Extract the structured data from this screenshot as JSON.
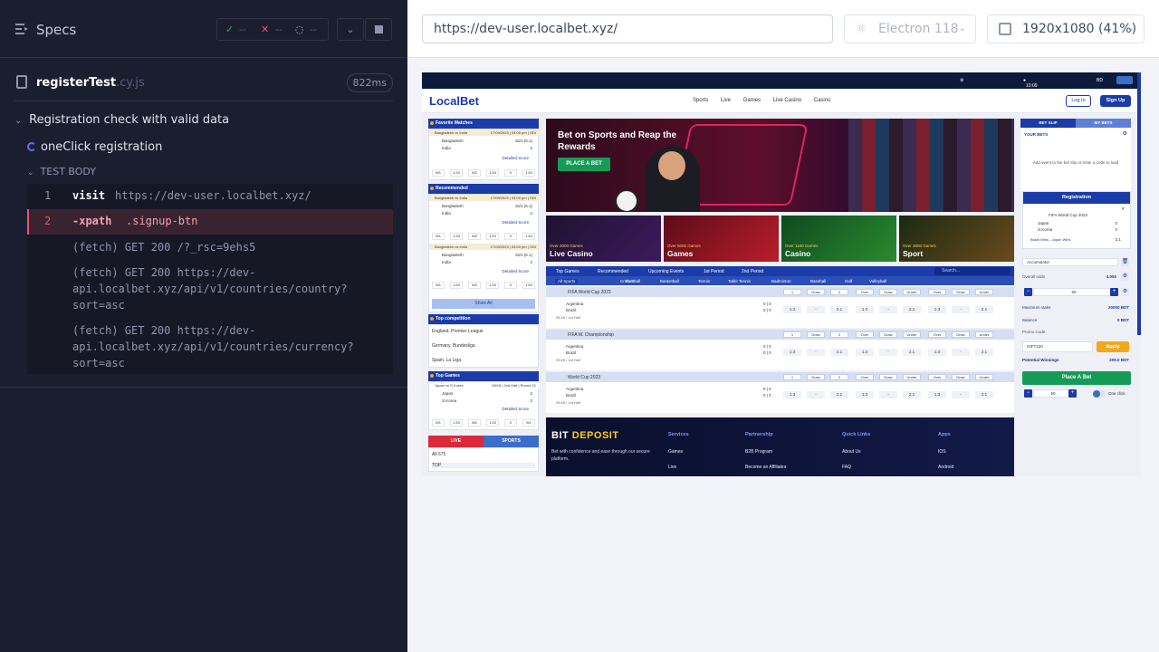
{
  "reporter": {
    "specs_label": "Specs",
    "stats": {
      "passed": "--",
      "failed": "--",
      "pending": "--"
    },
    "file": {
      "name": "registerTest",
      "ext": ".cy.js",
      "duration": "822ms"
    },
    "suite": "Registration check with valid data",
    "test": "oneClick registration",
    "body_label": "TEST BODY",
    "commands": [
      {
        "num": "1",
        "name": "visit",
        "message": "https://dev-user.localbet.xyz/"
      },
      {
        "num": "2",
        "name": "-xpath",
        "message": ".signup-btn"
      }
    ],
    "logs": [
      "(fetch)    GET 200 /?_rsc=9ehs5",
      "(fetch)    GET 200 https://dev-api.localbet.xyz/api/v1/countries/country?sort=asc",
      "(fetch)    GET 200 https://dev-api.localbet.xyz/api/v1/countries/currency?sort=asc"
    ]
  },
  "aut_header": {
    "url": "https://dev-user.localbet.xyz/",
    "browser": "Electron 118",
    "viewport": "1920x1080  (41%)"
  },
  "site": {
    "top_time": "10:09 AM",
    "top_lang": "BD",
    "logo": "LocalBet",
    "nav": [
      "Sports",
      "Live",
      "Games",
      "Live Casino",
      "Casino"
    ],
    "login": "Log In",
    "signup": "Sign Up",
    "left": {
      "favorites": "Favorite Matches",
      "recommended": "Recommended",
      "top_competition": "Top competition",
      "top_games": "Top Games",
      "match_title": "Bangladesh vs India",
      "match_date": "17/09/2023 | 03:00 pm | ODI",
      "team1": "Bangladesh",
      "team2": "India",
      "score1": "15/1 (6.1)",
      "score2": "2",
      "detailed": "Detailed Score",
      "odds": [
        "W1",
        "1.53",
        "W2",
        "1.53",
        "X",
        "1.53"
      ],
      "show_all": "Show All",
      "competitions": [
        "England. Premier League",
        "Germany. Bundesliga",
        "Spain. La Liga"
      ],
      "game_title": "Japan vs S.Korea",
      "game_date": "09/18 | 2nd Half | Round 21",
      "game_team1": "Japan",
      "game_team2": "S.Korea",
      "game_score1": "2",
      "game_score2": "2",
      "live_tab": "LIVE",
      "sports_tab": "SPORTS",
      "all_count": "All 675",
      "top": "TOP"
    },
    "hero": {
      "title": "Bet on Sports and Reap the Rewards",
      "button": "PLACE A BET"
    },
    "tiles": [
      {
        "over": "Over 3000 Games",
        "title": "Live Casino"
      },
      {
        "over": "Over 5000 Games",
        "title": "Games"
      },
      {
        "over": "Over 1100 Games",
        "title": "Casino"
      },
      {
        "over": "Over 3000 Games",
        "title": "Sport"
      }
    ],
    "events_bar": [
      "Top Games",
      "Recommended",
      "Upcoming Events",
      "1st Period",
      "2nd Period"
    ],
    "search": "Search...",
    "sports": [
      "All Sports",
      "Cricket",
      "Football",
      "Basketball",
      "Tennis",
      "Table Tennis",
      "Badminton",
      "Baseball",
      "Golf",
      "Volleyball"
    ],
    "games": [
      {
        "league": "FIFA World Cup 2023",
        "t1": "Argentina",
        "t2": "Brazil",
        "time": "25:45 / 1st Half"
      },
      {
        "league": "FIFA W. Championship",
        "t1": "Argentina",
        "t2": "Brazil",
        "time": "25:45 / 1st Half"
      },
      {
        "league": "World Cup 2023",
        "t1": "Argentina",
        "t2": "Brazil",
        "time": "25:45 / 1st Half"
      }
    ],
    "game_headers": [
      "1",
      "Draw",
      "2",
      "Over",
      "Draw",
      "Under",
      "Over",
      "Draw",
      "Under"
    ],
    "game_odds": [
      "1.3",
      "-",
      "2.1",
      "1.3",
      "-",
      "2.1",
      "1.3",
      "-",
      "2.1"
    ],
    "footer": {
      "logo_a": "BIT ",
      "logo_b": "DEPOSIT",
      "desc": "Bet with confidence and ease through our secure platform.",
      "cols": [
        {
          "h": "Services",
          "items": [
            "Games",
            "Live"
          ]
        },
        {
          "h": "Partnership",
          "items": [
            "B2B Program",
            "Become an Affiliates"
          ]
        },
        {
          "h": "Quick Links",
          "items": [
            "About Us",
            "FAQ"
          ]
        },
        {
          "h": "Apps",
          "items": [
            "IOS",
            "Android"
          ]
        }
      ]
    },
    "betslip": {
      "tab1": "BET SLIP",
      "tab2": "MY BETS",
      "your_bets": "YOUR BETS",
      "empty": "Add event to the bet slip or enter a code to load",
      "reg_title": "Registration",
      "reg_league": "FIFA World Cup 2023",
      "reg_t1": "Japan",
      "reg_t2": "S.Korea",
      "reg_s1": "0",
      "reg_s2": "0",
      "reg_line": "Brazil Wins - Japan Wins",
      "reg_odd": "2.1",
      "accumulator": "Accumulator",
      "overall_label": "Overall odds",
      "overall_val": "4.050",
      "stake": "50",
      "max_stake_label": "Maximum stake",
      "max_stake_val": "20000 BDT",
      "balance_label": "Balance",
      "balance_val": "0 BDT",
      "promo_label": "Promo Code",
      "promo_val": "GIFT220",
      "apply": "Apply",
      "potential_label": "Potential Winnings",
      "potential_val": "209.0 BDT",
      "place_bet": "Place A Bet",
      "stake2": "50",
      "one_click": "One click"
    }
  },
  "colors": {
    "accent": "#1a3ba8",
    "pass": "#1fa971",
    "fail": "#e45770",
    "reporter_bg": "#1b1e2e"
  }
}
